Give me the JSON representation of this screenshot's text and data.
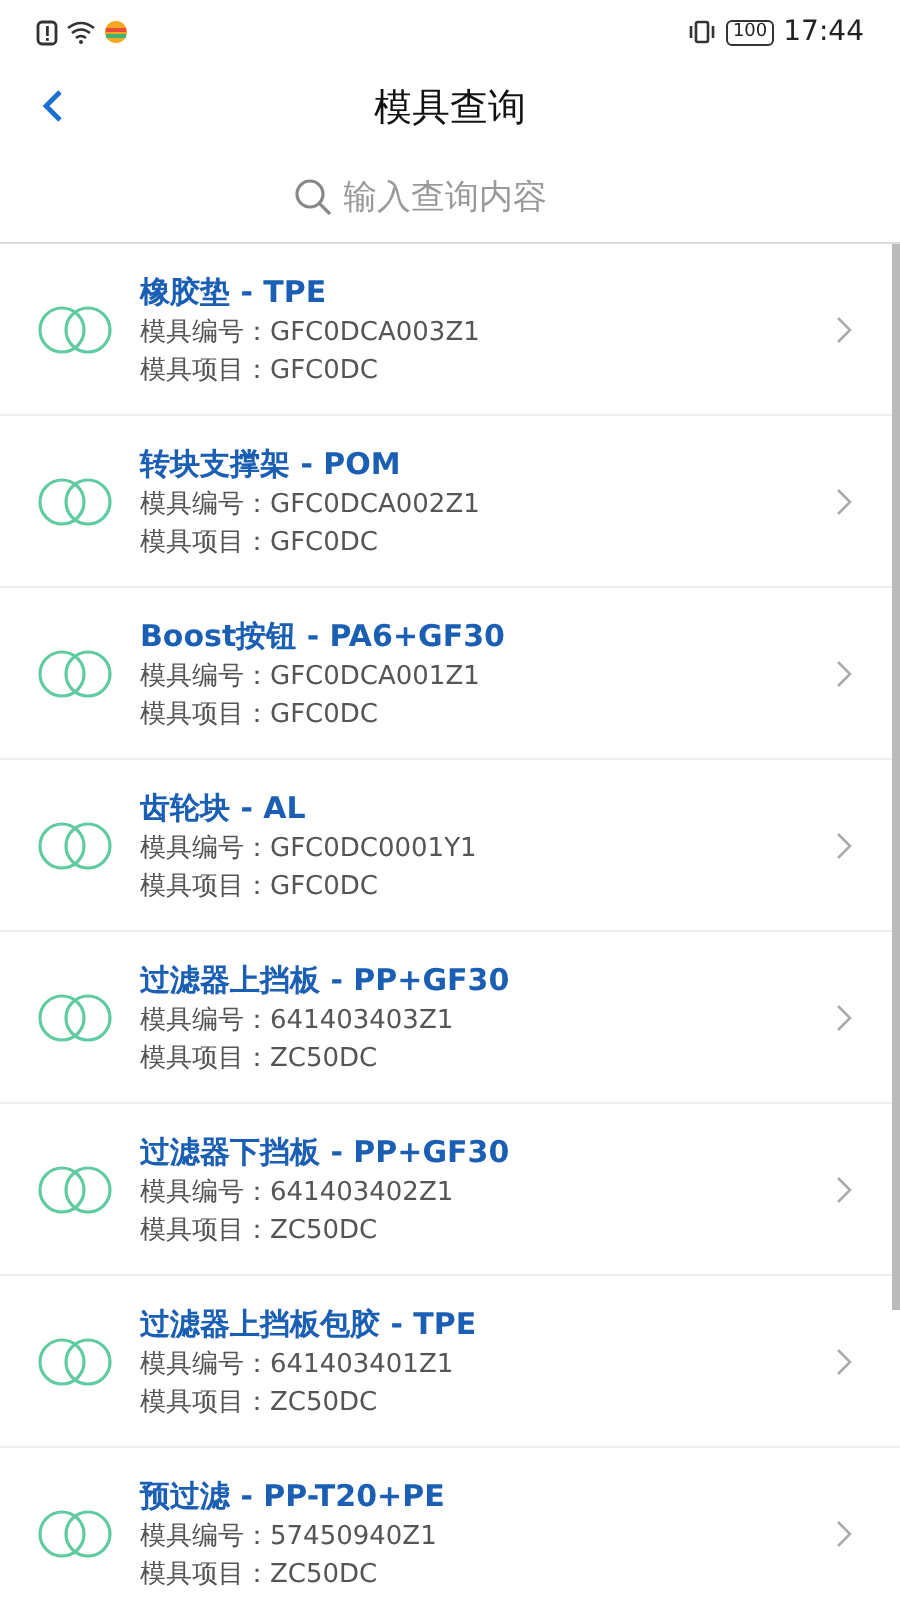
{
  "status_bar": {
    "battery": "100",
    "time": "17:44"
  },
  "header": {
    "title": "模具查询"
  },
  "search": {
    "placeholder": "输入查询内容"
  },
  "items": [
    {
      "title": "橡胶垫 - TPE",
      "code": "模具编号：GFC0DCA003Z1",
      "project": "模具项目：GFC0DC"
    },
    {
      "title": "转块支撑架 - POM",
      "code": "模具编号：GFC0DCA002Z1",
      "project": "模具项目：GFC0DC"
    },
    {
      "title": "Boost按钮 - PA6+GF30",
      "code": "模具编号：GFC0DCA001Z1",
      "project": "模具项目：GFC0DC"
    },
    {
      "title": "齿轮块 - AL",
      "code": "模具编号：GFC0DC0001Y1",
      "project": "模具项目：GFC0DC"
    },
    {
      "title": "过滤器上挡板 - PP+GF30",
      "code": "模具编号：641403403Z1",
      "project": "模具项目：ZC50DC"
    },
    {
      "title": "过滤器下挡板 - PP+GF30",
      "code": "模具编号：641403402Z1",
      "project": "模具项目：ZC50DC"
    },
    {
      "title": "过滤器上挡板包胶 - TPE",
      "code": "模具编号：641403401Z1",
      "project": "模具项目：ZC50DC"
    },
    {
      "title": "预过滤 - PP-T20+PE",
      "code": "模具编号：57450940Z1",
      "project": "模具项目：ZC50DC"
    }
  ]
}
